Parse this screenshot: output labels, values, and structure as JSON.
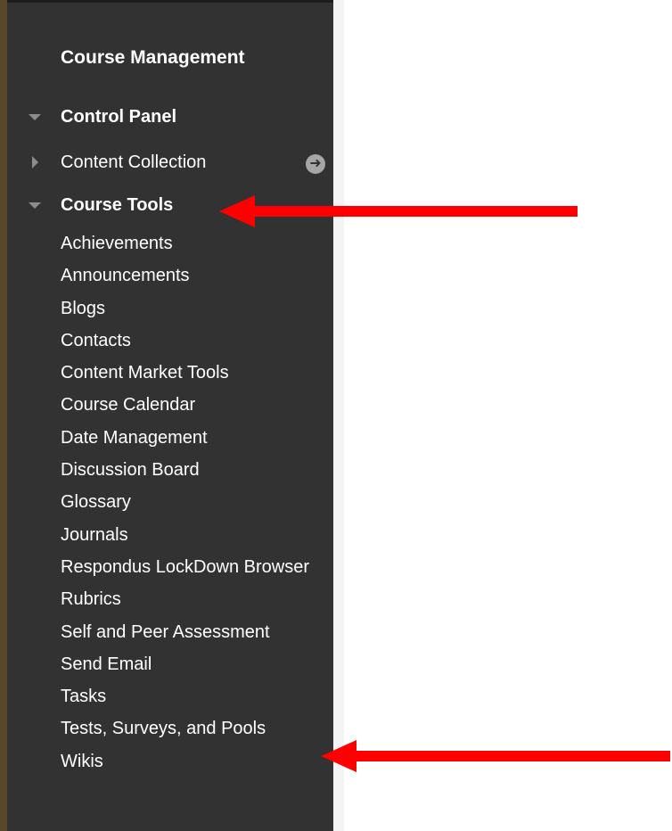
{
  "panel": {
    "title": "Course Management",
    "sections": {
      "control_panel": "Control Panel",
      "content_collection": "Content Collection",
      "course_tools": "Course Tools"
    },
    "tools": [
      "Achievements",
      "Announcements",
      "Blogs",
      "Contacts",
      "Content Market Tools",
      "Course Calendar",
      "Date Management",
      "Discussion Board",
      "Glossary",
      "Journals",
      "Respondus LockDown Browser",
      "Rubrics",
      "Self and Peer Assessment",
      "Send Email",
      "Tasks",
      "Tests, Surveys, and Pools",
      "Wikis"
    ]
  },
  "icons": {
    "expanded": "triangle-down-icon",
    "collapsed": "triangle-right-icon",
    "go": "arrow-circle-right-icon"
  },
  "colors": {
    "panel_background": "#323232",
    "left_border": "#5a4628",
    "annotation_arrow": "#ff0000"
  }
}
